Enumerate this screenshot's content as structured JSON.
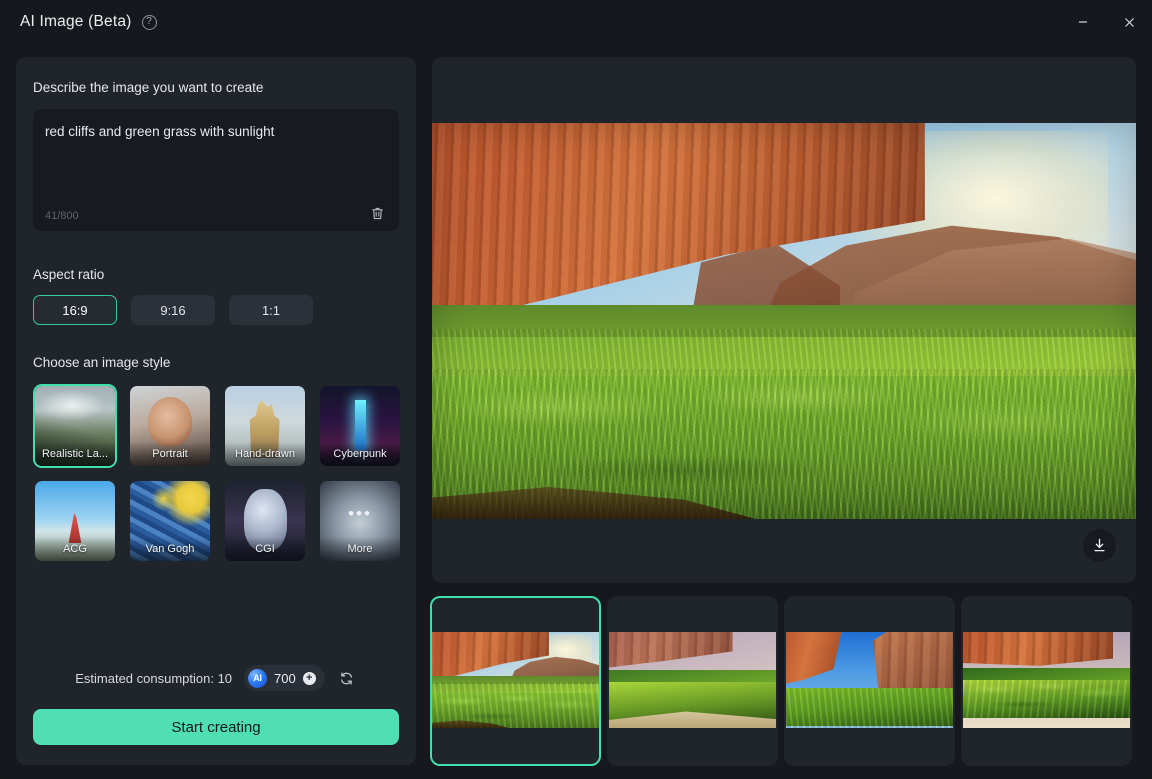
{
  "window": {
    "title": "AI Image (Beta)",
    "help_icon": "question-circle-icon",
    "minimize_label": "–",
    "close_label": "✕"
  },
  "left_panel": {
    "describe_label": "Describe the image you want to create",
    "prompt": {
      "value": "red cliffs and green grass with sunlight",
      "placeholder": "Describe the image you want to create",
      "char_count": "41/800",
      "clear_icon": "trash-icon"
    },
    "aspect_ratio": {
      "label": "Aspect ratio",
      "options": [
        {
          "label": "16:9",
          "selected": true
        },
        {
          "label": "9:16",
          "selected": false
        },
        {
          "label": "1:1",
          "selected": false
        }
      ]
    },
    "image_style": {
      "label": "Choose an image style",
      "options": [
        {
          "label": "Realistic La...",
          "selected": true,
          "scene": "sc-realistic"
        },
        {
          "label": "Portrait",
          "selected": false,
          "scene": "sc-portrait"
        },
        {
          "label": "Hand-drawn",
          "selected": false,
          "scene": "sc-hand"
        },
        {
          "label": "Cyberpunk",
          "selected": false,
          "scene": "sc-cyber"
        },
        {
          "label": "ACG",
          "selected": false,
          "scene": "sc-acg"
        },
        {
          "label": "Van Gogh",
          "selected": false,
          "scene": "sc-vangogh"
        },
        {
          "label": "CGI",
          "selected": false,
          "scene": "sc-cgi"
        },
        {
          "label": "More",
          "selected": false,
          "scene": "sc-more"
        }
      ]
    },
    "consumption": {
      "label": "Estimated consumption: 10",
      "credit_icon": "ai-credit-icon",
      "credit_badge_text": "AI",
      "credit_amount": "700",
      "add_icon": "plus-circle-icon",
      "refresh_icon": "refresh-icon"
    },
    "create_button": "Start creating"
  },
  "preview": {
    "download_icon": "download-icon",
    "alt": "Generated landscape: red sandstone cliffs above sunlit green grass field",
    "results": [
      {
        "name": "result-1",
        "selected": true,
        "alt": "Close-up sunlit green grass before red cliff canyon"
      },
      {
        "name": "result-2",
        "selected": false,
        "alt": "Rolling green hills with red mesa and sandy path"
      },
      {
        "name": "result-3",
        "selected": false,
        "alt": "Narrow red canyon with bright green meadow"
      },
      {
        "name": "result-4",
        "selected": false,
        "alt": "Layered green hills under red rock wall"
      }
    ]
  },
  "colors": {
    "accent_green": "#3fe0ac",
    "button_green": "#4fdfb2",
    "panel_bg": "#20242b",
    "window_bg": "#16181d",
    "input_bg": "#171a20",
    "chip_bg": "#2b3039"
  }
}
